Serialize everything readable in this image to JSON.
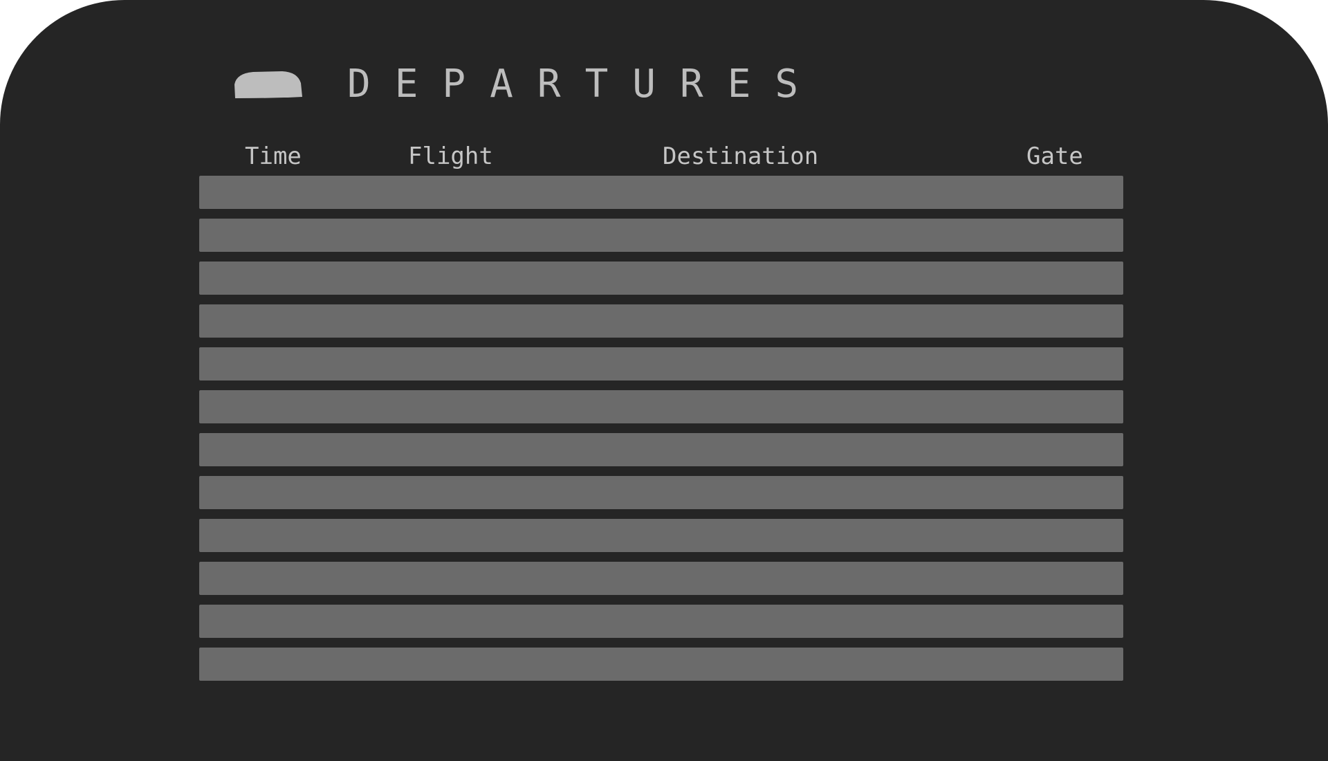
{
  "board": {
    "title": "DEPARTURES",
    "icon": "plane-icon",
    "columns": {
      "time": "Time",
      "flight": "Flight",
      "destination": "Destination",
      "gate": "Gate"
    },
    "row_count": 12
  },
  "colors": {
    "board_background": "#252525",
    "row_fill": "#6b6b6b",
    "text": "#bdbdbd"
  }
}
